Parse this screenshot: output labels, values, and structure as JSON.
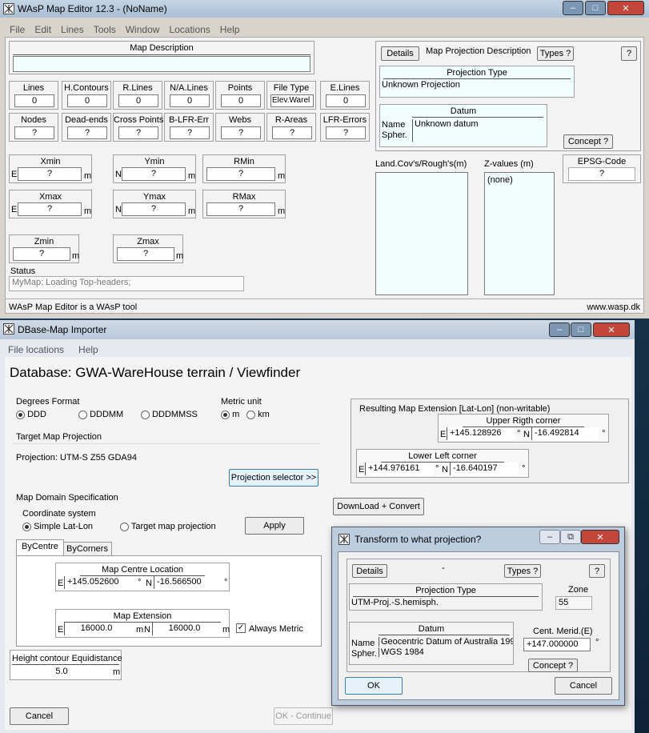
{
  "editor": {
    "title": "WAsP Map Editor 12.3 - (NoName)",
    "menu": [
      "File",
      "Edit",
      "Lines",
      "Tools",
      "Window",
      "Locations",
      "Help"
    ],
    "map_description_label": "Map Description",
    "counts": [
      {
        "label": "Lines",
        "value": "0"
      },
      {
        "label": "H.Contours",
        "value": "0"
      },
      {
        "label": "R.Lines",
        "value": "0"
      },
      {
        "label": "N/A.Lines",
        "value": "0"
      },
      {
        "label": "Points",
        "value": "0"
      },
      {
        "label": "File Type",
        "value": "Elev.Warel"
      },
      {
        "label": "E.Lines",
        "value": "0"
      },
      {
        "label": "Nodes",
        "value": "?"
      },
      {
        "label": "Dead-ends",
        "value": "?"
      },
      {
        "label": "Cross Points",
        "value": "?"
      },
      {
        "label": "B-LFR-Err",
        "value": "?"
      },
      {
        "label": "Webs",
        "value": "?"
      },
      {
        "label": "R-Areas",
        "value": "?"
      },
      {
        "label": "LFR-Errors",
        "value": "?"
      }
    ],
    "extents": [
      {
        "label": "Xmin",
        "prefix": "E",
        "value": "?",
        "unit": "m"
      },
      {
        "label": "Ymin",
        "prefix": "N",
        "value": "?",
        "unit": "m"
      },
      {
        "label": "RMin",
        "prefix": "",
        "value": "?",
        "unit": "m"
      },
      {
        "label": "Xmax",
        "prefix": "E",
        "value": "?",
        "unit": "m"
      },
      {
        "label": "Ymax",
        "prefix": "N",
        "value": "?",
        "unit": "m"
      },
      {
        "label": "RMax",
        "prefix": "",
        "value": "?",
        "unit": "m"
      },
      {
        "label": "Zmin",
        "prefix": "",
        "value": "?",
        "unit": "m"
      },
      {
        "label": "Zmax",
        "prefix": "",
        "value": "?",
        "unit": "m"
      }
    ],
    "status_label": "Status",
    "status_text": "MyMap: Loading Top-headers;",
    "details_btn": "Details",
    "proj_desc_label": "Map Projection Description",
    "types_btn": "Types ?",
    "help_btn": "?",
    "proj_type_label": "Projection Type",
    "proj_type_value": "Unknown Projection",
    "datum_label": "Datum",
    "datum_name_label": "Name",
    "datum_spher_label": "Spher.",
    "datum_value": "Unknown datum",
    "concept_btn": "Concept ?",
    "epsg_label": "EPSG-Code",
    "epsg_value": "?",
    "landcov_label": "Land.Cov's/Rough's(m)",
    "zvalues_label": "Z-values (m)",
    "zvalues_item": "(none)",
    "footer_left": "WAsP Map Editor is a WAsP tool",
    "footer_right": "www.wasp.dk"
  },
  "importer": {
    "title": "DBase-Map Importer",
    "menu": [
      "File locations",
      "Help"
    ],
    "heading": "Database: GWA-WareHouse terrain / Viewfinder",
    "degrees_label": "Degrees Format",
    "degrees_options": [
      "DDD",
      "DDDMM",
      "DDDMMSS"
    ],
    "metric_label": "Metric unit",
    "metric_options": [
      "m",
      "km"
    ],
    "target_proj_label": "Target Map Projection",
    "projection_text": "Projection: UTM-S Z55 GDA94",
    "proj_selector_btn": "Projection selector >>",
    "result_label": "Resulting Map Extension [Lat-Lon] (non-writable)",
    "upper_right_label": "Upper Rigth corner",
    "upper_right_e": "+145.128926",
    "upper_right_n": "-16.492814",
    "lower_left_label": "Lower Left corner",
    "lower_left_e": "+144.976161",
    "lower_left_n": "-16.640197",
    "domain_label": "Map Domain Specification",
    "coord_sys_label": "Coordinate system",
    "coord_options": [
      "Simple Lat-Lon",
      "Target map projection"
    ],
    "apply_btn": "Apply",
    "download_btn": "DownLoad + Convert",
    "tabs": [
      "ByCentre",
      "ByCorners"
    ],
    "centre_label": "Map Centre Location",
    "centre_e": "+145.052600",
    "centre_n": "-16.566500",
    "extension_label": "Map Extension",
    "extension_e": "16000.0",
    "extension_n": "16000.0",
    "always_metric": "Always Metric",
    "height_label": "Height contour Equidistance",
    "height_value": "5.0",
    "cancel_btn": "Cancel",
    "ok_continue_btn": "OK - Continue",
    "deg_sym": "°",
    "unit_m": "m",
    "e_prefix": "E",
    "n_prefix": "N"
  },
  "dialog": {
    "title": "Transform to what projection?",
    "details_btn": "Details",
    "dash": "-",
    "types_btn": "Types ?",
    "help_btn": "?",
    "proj_type_label": "Projection Type",
    "proj_type_value": "UTM-Proj.-S.hemisph.",
    "zone_label": "Zone",
    "zone_value": "55",
    "datum_label": "Datum",
    "name_label": "Name",
    "spher_label": "Spher.",
    "datum_name": "Geocentric Datum of Australia 199",
    "datum_spher": "WGS 1984",
    "cent_merid_label": "Cent. Merid.(E)",
    "cent_merid_value": "+147.000000",
    "concept_btn": "Concept ?",
    "ok_btn": "OK",
    "cancel_btn": "Cancel"
  },
  "colors": {
    "close_red": "#c4463a",
    "cyan_field": "#f0fffd",
    "panel": "#f3f3f3",
    "frame": "#d4d0c8"
  }
}
